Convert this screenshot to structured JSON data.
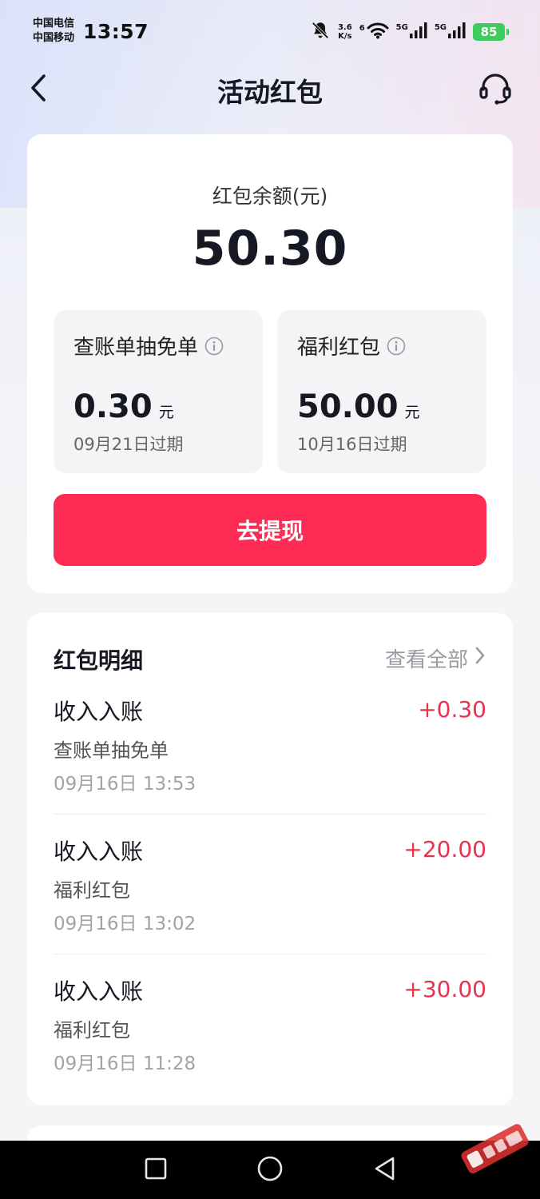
{
  "status_bar": {
    "carrier_1": "中国电信",
    "carrier_2": "中国移动",
    "time": "13:57",
    "speed_value": "3.6",
    "speed_unit": "K/s",
    "wifi_label": "6",
    "network_1": "5G",
    "network_2": "5G",
    "battery": "85",
    "icons": [
      "bell-off-icon",
      "wifi-icon",
      "signal-icon",
      "signal-icon",
      "battery-icon"
    ]
  },
  "header": {
    "title": "活动红包",
    "back_icon": "chevron-left-icon",
    "service_icon": "headset-icon"
  },
  "balance": {
    "label": "红包余额(元)",
    "amount": "50.30"
  },
  "sub_balances": [
    {
      "title": "查账单抽免单",
      "amount": "0.30",
      "unit": "元",
      "expire": "09月21日过期"
    },
    {
      "title": "福利红包",
      "amount": "50.00",
      "unit": "元",
      "expire": "10月16日过期"
    }
  ],
  "withdraw_button": "去提现",
  "details": {
    "title": "红包明细",
    "view_all": "查看全部",
    "records": [
      {
        "type": "收入入账",
        "source": "查账单抽免单",
        "time": "09月16日 13:53",
        "amount": "+0.30"
      },
      {
        "type": "收入入账",
        "source": "福利红包",
        "time": "09月16日 13:02",
        "amount": "+20.00"
      },
      {
        "type": "收入入账",
        "source": "福利红包",
        "time": "09月16日 11:28",
        "amount": "+30.00"
      }
    ]
  },
  "nav_bar": {
    "icons": [
      "square-icon",
      "circle-icon",
      "triangle-back-icon"
    ]
  },
  "colors": {
    "accent": "#fe2c55",
    "income": "#e7334f",
    "battery": "#3fcc5f"
  }
}
